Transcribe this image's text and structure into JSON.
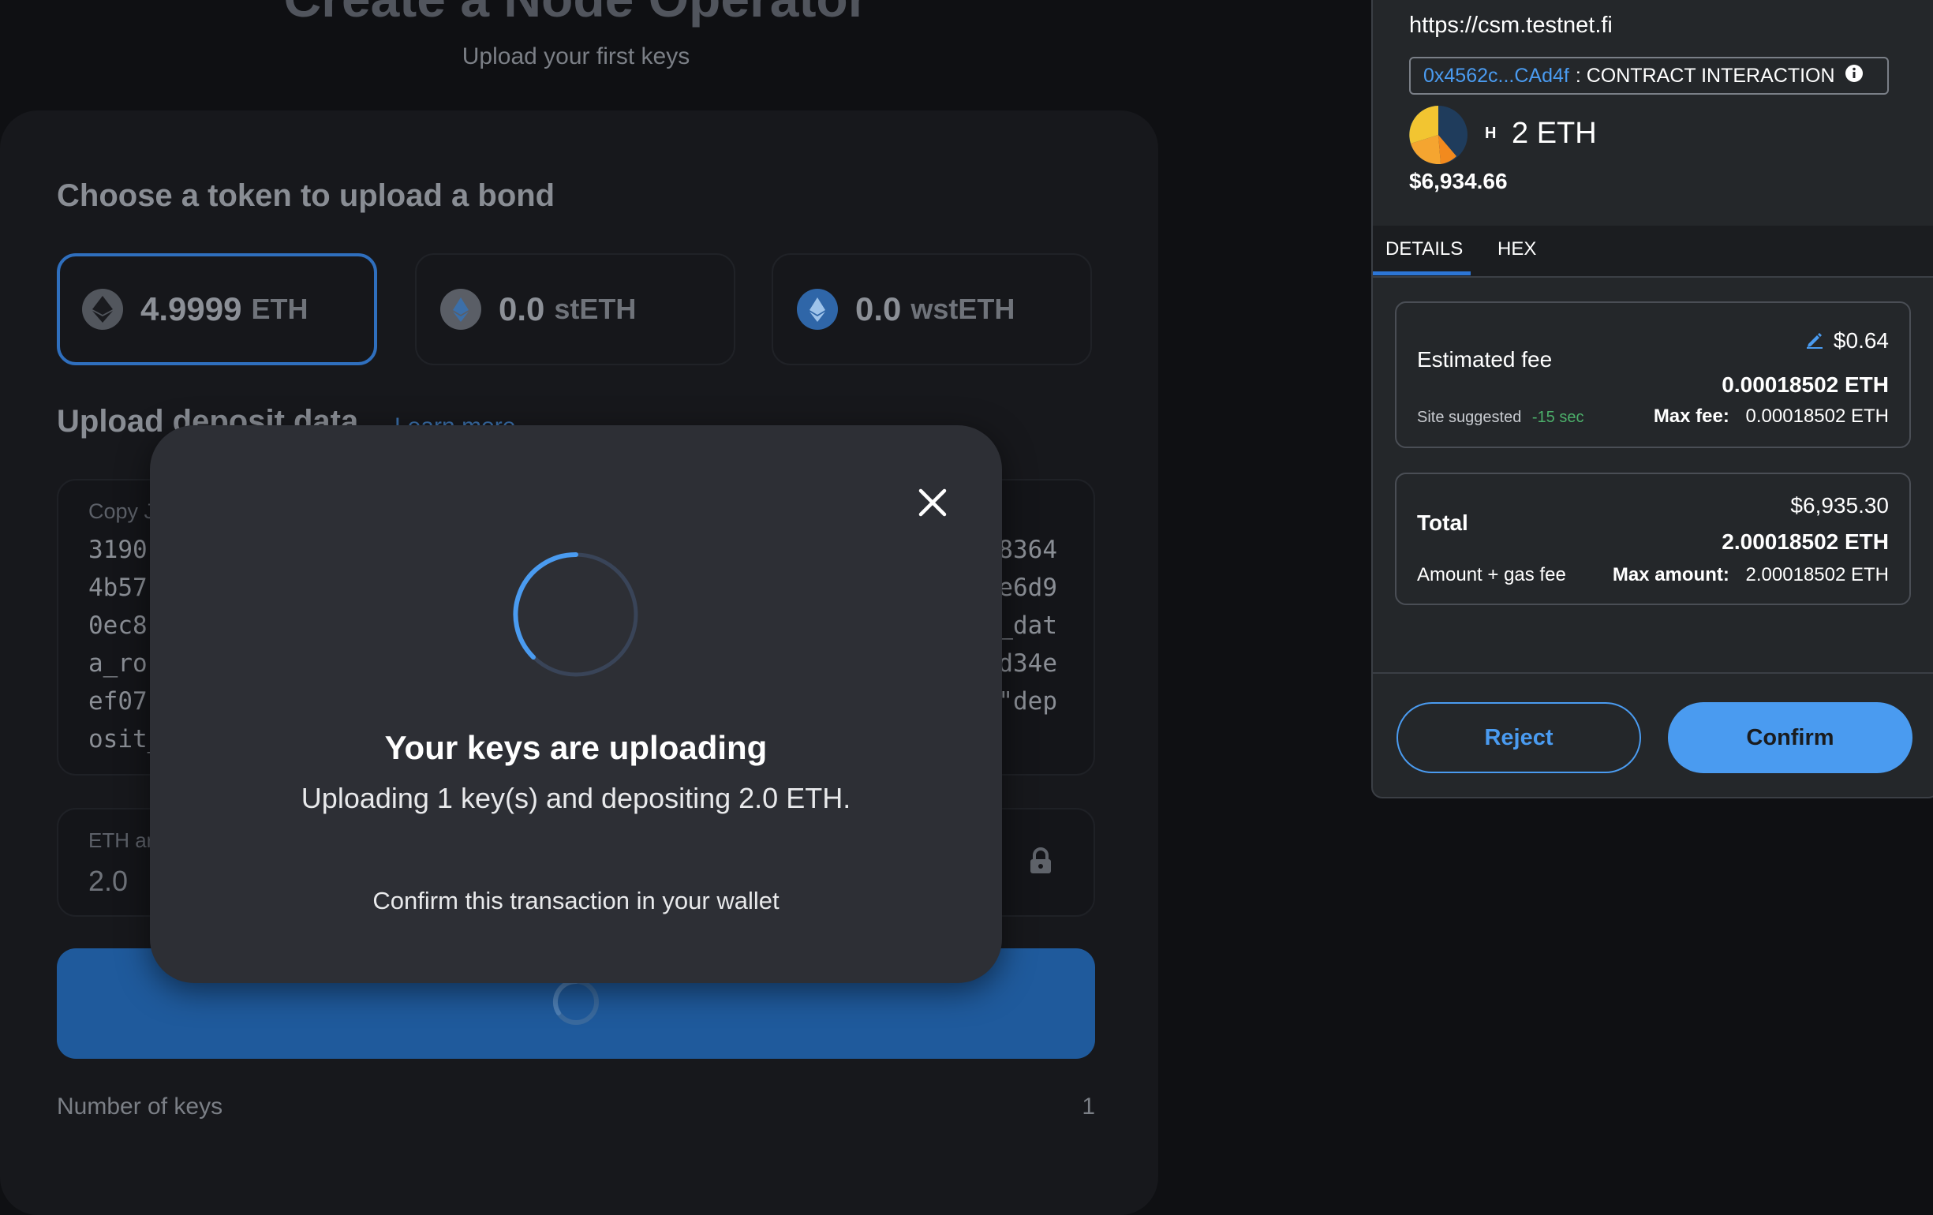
{
  "page": {
    "title": "Create a Node Operator",
    "subtitle": "Upload your first keys"
  },
  "bond": {
    "heading": "Choose a token to upload a bond",
    "tokens": [
      {
        "amount": "4.9999",
        "unit": "ETH",
        "icon": "eth-icon",
        "selected": true
      },
      {
        "amount": "0.0",
        "unit": "stETH",
        "icon": "steth-icon",
        "selected": false
      },
      {
        "amount": "0.0",
        "unit": "wstETH",
        "icon": "wsteth-icon",
        "selected": false
      }
    ]
  },
  "deposit": {
    "heading": "Upload deposit data",
    "learn_more": "Learn more",
    "json_label": "Copy J",
    "json_left": [
      "3190",
      "4b57",
      "0ec8",
      "a_ro",
      "ef07",
      "osit_"
    ],
    "json_right": [
      "8364",
      "e6d9",
      "_dat",
      "d34e",
      "\"dep",
      ""
    ]
  },
  "eth_amount": {
    "label": "ETH ar",
    "value": "2.0"
  },
  "summary": {
    "keys_label": "Number of keys",
    "keys_value": "1"
  },
  "modal": {
    "title": "Your keys are uploading",
    "text": "Uploading 1 key(s) and depositing 2.0 ETH.",
    "hint": "Confirm this transaction in your wallet"
  },
  "wallet": {
    "origin": "https://csm.testnet.fi",
    "contract_address": "0x4562c...CAd4f",
    "contract_label": ": CONTRACT INTERACTION",
    "network_badge": "H",
    "amount": "2 ETH",
    "amount_usd": "$6,934.66",
    "tabs": [
      "DETAILS",
      "HEX"
    ],
    "fee": {
      "label": "Estimated fee",
      "usd": "$0.64",
      "eth": "0.00018502 ETH",
      "site_suggested": "Site suggested",
      "time": "-15 sec",
      "max_fee_label": "Max fee:",
      "max_fee_value": "0.00018502 ETH"
    },
    "total": {
      "label": "Total",
      "usd": "$6,935.30",
      "eth": "2.00018502 ETH",
      "sub_label": "Amount + gas fee",
      "max_amount_label": "Max amount:",
      "max_amount_value": "2.00018502 ETH"
    },
    "reject_label": "Reject",
    "confirm_label": "Confirm"
  },
  "colors": {
    "accent": "#4a9bf0",
    "submit_bar": "#1f5a9c",
    "suggested_time": "#4caf6a"
  }
}
